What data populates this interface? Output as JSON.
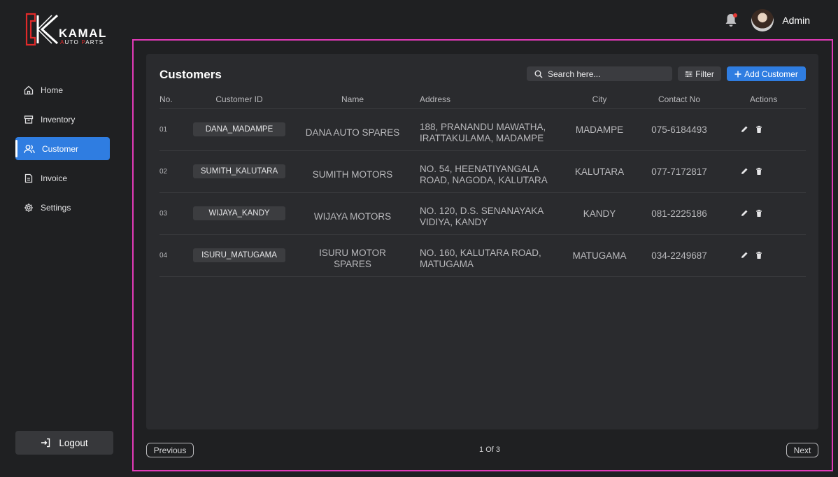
{
  "brand": {
    "name": "KAMAL",
    "sub_highlight_1": "A",
    "sub_rest_1": "UTO ",
    "sub_highlight_2": "P",
    "sub_rest_2": "ARTS"
  },
  "topbar": {
    "user_name": "Admin"
  },
  "sidebar": {
    "items": [
      {
        "label": "Home",
        "icon": "home-icon",
        "active": false
      },
      {
        "label": "Inventory",
        "icon": "inventory-icon",
        "active": false
      },
      {
        "label": "Customer",
        "icon": "users-icon",
        "active": true
      },
      {
        "label": "Invoice",
        "icon": "invoice-icon",
        "active": false
      },
      {
        "label": "Settings",
        "icon": "gear-icon",
        "active": false
      }
    ],
    "logout_label": "Logout"
  },
  "main": {
    "title": "Customers",
    "search_placeholder": "Search here...",
    "filter_label": "Filter",
    "add_label": "Add Customer",
    "columns": [
      "No.",
      "Customer ID",
      "Name",
      "Address",
      "City",
      "Contact No",
      "Actions"
    ],
    "rows": [
      {
        "no": "01",
        "id": "DANA_MADAMPE",
        "name_lines": [
          "DANA AUTO SPARES"
        ],
        "address_lines": [
          "188, PRANANDU MAWATHA,",
          "IRATTAKULAMA, MADAMPE"
        ],
        "city": "MADAMPE",
        "contact": "075-6184493"
      },
      {
        "no": "02",
        "id": "SUMITH_KALUTARA",
        "name_lines": [
          "SUMITH MOTORS"
        ],
        "address_lines": [
          "NO. 54, HEENATIYANGALA",
          "ROAD, NAGODA, KALUTARA"
        ],
        "city": "KALUTARA",
        "contact": "077-7172817"
      },
      {
        "no": "03",
        "id": "WIJAYA_KANDY",
        "name_lines": [
          "WIJAYA MOTORS"
        ],
        "address_lines": [
          "NO. 120, D.S. SENANAYAKA",
          "VIDIYA, KANDY"
        ],
        "city": "KANDY",
        "contact": "081-2225186"
      },
      {
        "no": "04",
        "id": "ISURU_MATUGAMA",
        "name_lines": [
          "ISURU MOTOR",
          "SPARES"
        ],
        "address_lines": [
          "NO. 160, KALUTARA ROAD,",
          "MATUGAMA"
        ],
        "city": "MATUGAMA",
        "contact": "034-2249687"
      }
    ]
  },
  "pagination": {
    "previous_label": "Previous",
    "page_info": "1 Of 3",
    "next_label": "Next"
  },
  "colors": {
    "accent": "#2f7de1",
    "frame": "#e23ab8",
    "brand_red": "#e02a2a"
  }
}
